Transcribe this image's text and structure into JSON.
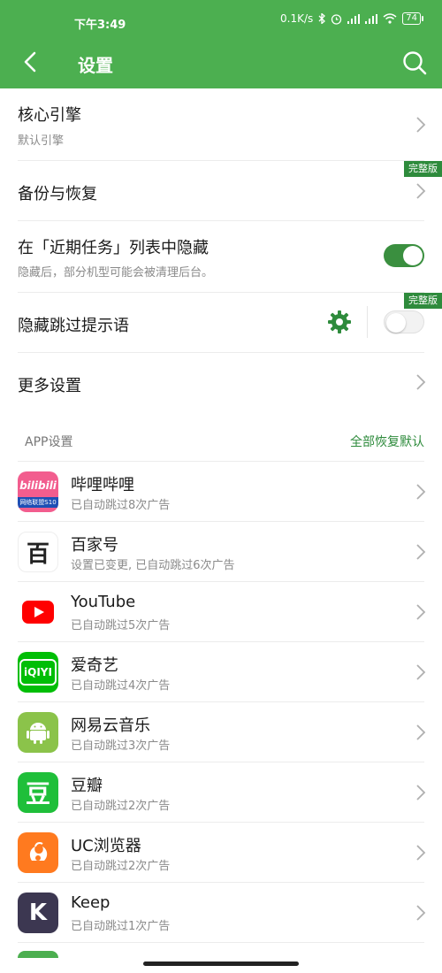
{
  "status_bar": {
    "time": "下午3:49",
    "network_speed": "0.1K/s",
    "battery": "74",
    "icons": [
      "bluetooth-icon",
      "alarm-icon",
      "signal-icon",
      "signal-icon",
      "wifi-icon",
      "battery-icon"
    ]
  },
  "app_bar": {
    "title": "设置",
    "back_icon": "back-arrow-icon",
    "search_icon": "search-icon",
    "color": "#4caf50"
  },
  "settings": {
    "core_engine": {
      "title": "核心引擎",
      "subtitle": "默认引擎"
    },
    "backup": {
      "title": "备份与恢复",
      "badge": "完整版"
    },
    "hide_recent": {
      "title": "在「近期任务」列表中隐藏",
      "subtitle": "隐藏后，部分机型可能会被清理后台。",
      "enabled": true
    },
    "hide_skip_tip": {
      "title": "隐藏跳过提示语",
      "badge": "完整版",
      "enabled": false
    },
    "more": {
      "title": "更多设置"
    }
  },
  "app_section": {
    "label": "APP设置",
    "restore_all": "全部恢复默认",
    "apps": [
      {
        "name": "哔哩哔哩",
        "desc": "已自动跳过8次广告",
        "icon": "bilibili-icon"
      },
      {
        "name": "百家号",
        "desc": "设置已变更, 已自动跳过6次广告",
        "icon": "baijiahao-icon"
      },
      {
        "name": "YouTube",
        "desc": "已自动跳过5次广告",
        "icon": "youtube-icon"
      },
      {
        "name": "爱奇艺",
        "desc": "已自动跳过4次广告",
        "icon": "iqiyi-icon"
      },
      {
        "name": "网易云音乐",
        "desc": "已自动跳过3次广告",
        "icon": "android-icon"
      },
      {
        "name": "豆瓣",
        "desc": "已自动跳过2次广告",
        "icon": "douban-icon"
      },
      {
        "name": "UC浏览器",
        "desc": "已自动跳过2次广告",
        "icon": "uc-browser-icon"
      },
      {
        "name": "Keep",
        "desc": "已自动跳过1次广告",
        "icon": "keep-icon"
      }
    ]
  },
  "icon_text": {
    "bilibili": "bilibili",
    "bilibili_sub": "网络联盟S10",
    "baijiahao": "百",
    "iqiyi": "iQIYI",
    "douban": "豆",
    "keep": "K"
  },
  "colors": {
    "accent": "#4caf50",
    "toggle_on": "#3a8f3f",
    "badge": "#2e8b3c",
    "link": "#2e8b3c"
  }
}
